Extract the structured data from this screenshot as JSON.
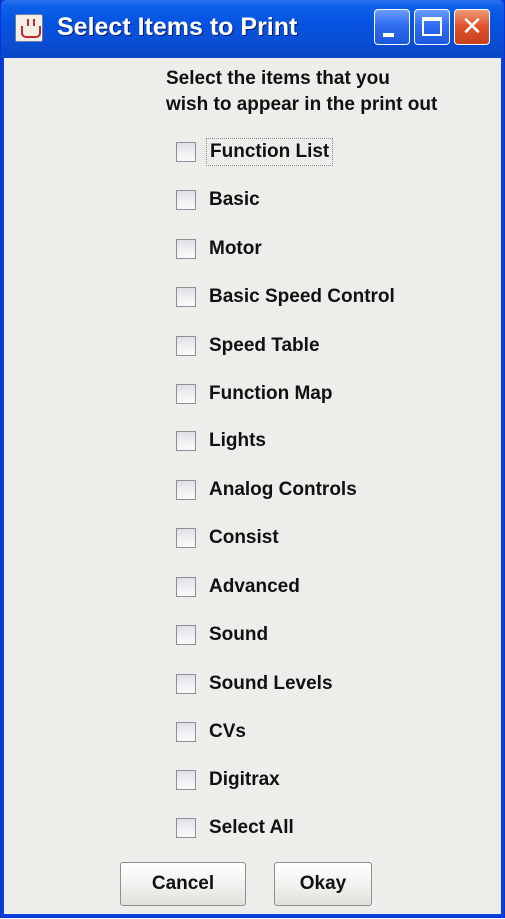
{
  "window": {
    "title": "Select Items to Print",
    "icon": "java-cup-icon",
    "controls": {
      "minimize": "minimize-icon",
      "maximize": "maximize-icon",
      "close_glyph": "✕"
    }
  },
  "instructions": {
    "line1": "Select the items that you",
    "line2": "wish to appear in the print out"
  },
  "items": [
    {
      "label": "Function List",
      "checked": false,
      "focused": true
    },
    {
      "label": "Basic",
      "checked": false
    },
    {
      "label": "Motor",
      "checked": false
    },
    {
      "label": "Basic Speed Control",
      "checked": false
    },
    {
      "label": "Speed Table",
      "checked": false
    },
    {
      "label": "Function Map",
      "checked": false
    },
    {
      "label": "Lights",
      "checked": false
    },
    {
      "label": "Analog Controls",
      "checked": false
    },
    {
      "label": "Consist",
      "checked": false
    },
    {
      "label": "Advanced",
      "checked": false
    },
    {
      "label": "Sound",
      "checked": false
    },
    {
      "label": "Sound Levels",
      "checked": false
    },
    {
      "label": "CVs",
      "checked": false
    },
    {
      "label": "Digitrax",
      "checked": false
    },
    {
      "label": "Select All",
      "checked": false
    }
  ],
  "buttons": {
    "cancel": "Cancel",
    "okay": "Okay"
  },
  "colors": {
    "titlebar": "#0553e1",
    "client_background": "#efedea",
    "close_button": "#e2552e"
  }
}
